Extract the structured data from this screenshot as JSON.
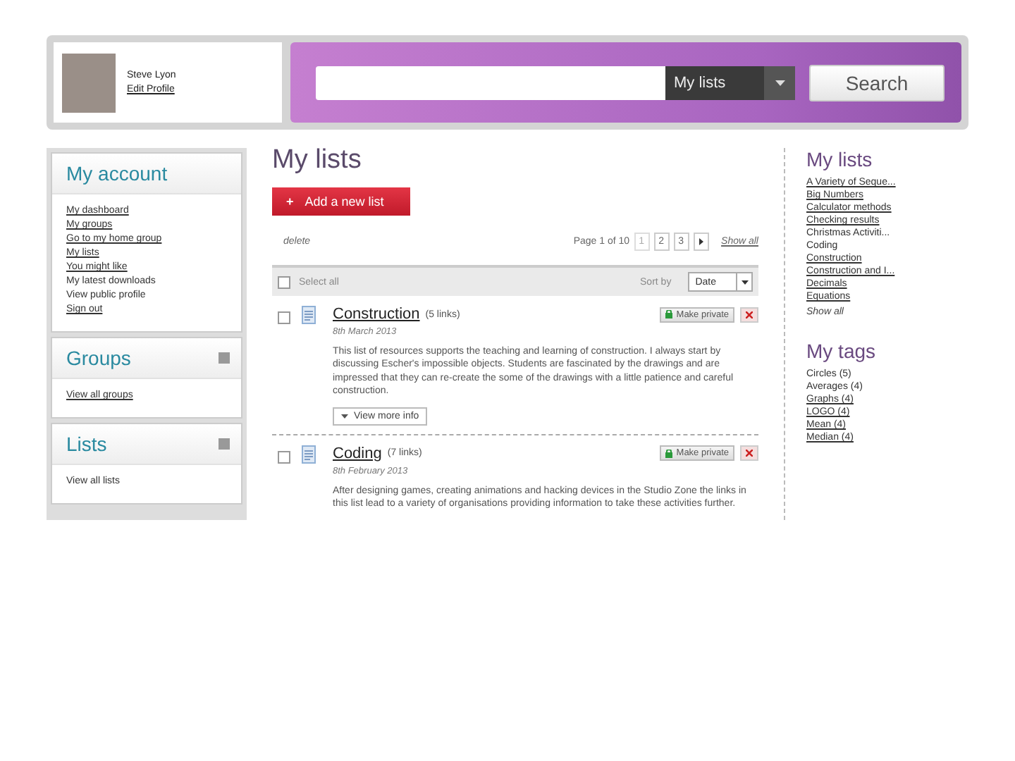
{
  "header": {
    "user_name": "Steve Lyon",
    "edit_profile": "Edit Profile",
    "search": {
      "scope": "My lists",
      "button": "Search"
    }
  },
  "sidebar": {
    "panels": [
      {
        "title": "My account",
        "has_help": false,
        "links": [
          {
            "label": "My dashboard",
            "kind": "link"
          },
          {
            "label": "My groups",
            "kind": "link"
          },
          {
            "label": "Go to my home group",
            "kind": "link"
          },
          {
            "label": "My lists",
            "kind": "link"
          },
          {
            "label": "You might like",
            "kind": "link"
          },
          {
            "label": "My latest downloads",
            "kind": "text"
          },
          {
            "label": "View public profile",
            "kind": "text"
          },
          {
            "label": "Sign out",
            "kind": "link"
          }
        ]
      },
      {
        "title": "Groups",
        "has_help": true,
        "links": [
          {
            "label": "View all groups",
            "kind": "link"
          }
        ]
      },
      {
        "title": "Lists",
        "has_help": true,
        "links": [
          {
            "label": "View all lists",
            "kind": "text"
          }
        ]
      }
    ]
  },
  "main": {
    "title": "My lists",
    "add_icon": "+",
    "add_button": "Add a new list",
    "delete": "delete",
    "pagination": {
      "label": "Page 1 of 10",
      "pages": [
        {
          "label": "1",
          "selected": true
        },
        {
          "label": "2",
          "selected": false
        },
        {
          "label": "3",
          "selected": false
        }
      ],
      "show_all": "Show all"
    },
    "toolbar": {
      "select_all": "Select all",
      "select_all_checked": false,
      "sort_label": "Sort by",
      "sort_value": "Date"
    },
    "lists": [
      {
        "title": "Construction",
        "links": "(5 links)",
        "date": "8th March 2013",
        "checked": false,
        "description": "This list of resources supports the teaching and learning of construction. I always start by discussing Escher's impossible objects. Students are fascinated by the drawings and are impressed that they can re-create the some of the drawings with a little patience and careful construction.",
        "privacy_button": "Make private",
        "more_info": "View more info"
      },
      {
        "title": "Coding",
        "links": "(7 links)",
        "date": "8th February 2013",
        "checked": false,
        "description": "After designing games, creating animations and hacking devices in the Studio Zone the links in this list lead to a variety of organisations providing information to take these activities further.",
        "privacy_button": "Make private"
      }
    ]
  },
  "right": {
    "lists_title": "My lists",
    "lists": [
      {
        "label": "A Variety of Seque...",
        "kind": "link"
      },
      {
        "label": "Big Numbers",
        "kind": "link"
      },
      {
        "label": "Calculator methods",
        "kind": "link"
      },
      {
        "label": "Checking results",
        "kind": "link"
      },
      {
        "label": "Christmas Activiti...",
        "kind": "text"
      },
      {
        "label": "Coding",
        "kind": "text"
      },
      {
        "label": "Construction",
        "kind": "link"
      },
      {
        "label": "Construction and I...",
        "kind": "link"
      },
      {
        "label": "Decimals",
        "kind": "link"
      },
      {
        "label": "Equations",
        "kind": "link"
      }
    ],
    "show_all": "Show all",
    "tags_title": "My tags",
    "tags": [
      {
        "label": "Circles (5)",
        "kind": "text"
      },
      {
        "label": "Averages (4)",
        "kind": "text"
      },
      {
        "label": "Graphs (4)",
        "kind": "link"
      },
      {
        "label": "LOGO (4)",
        "kind": "link"
      },
      {
        "label": "Mean (4)",
        "kind": "link"
      },
      {
        "label": "Median (4)",
        "kind": "link"
      }
    ]
  }
}
